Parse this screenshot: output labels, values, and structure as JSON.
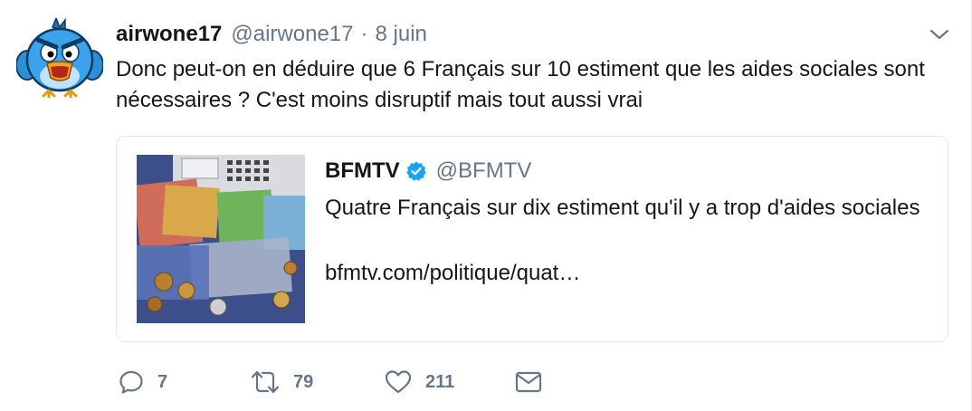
{
  "tweet": {
    "display_name": "airwone17",
    "handle": "@airwone17",
    "separator": "·",
    "date": "8 juin",
    "text": "Donc peut-on en déduire que 6 Français sur 10 estiment que les aides sociales sont nécessaires ? C'est moins disruptif mais tout aussi vrai"
  },
  "quote": {
    "display_name": "BFMTV",
    "handle": "@BFMTV",
    "text": "Quatre Français sur dix estiment qu'il y a trop d'aides sociales",
    "link": "bfmtv.com/politique/quat…"
  },
  "actions": {
    "replies": "7",
    "retweets": "79",
    "likes": "211"
  },
  "icons": {
    "reply": "reply-icon",
    "retweet": "retweet-icon",
    "like": "heart-icon",
    "dm": "envelope-icon",
    "more": "chevron-down-icon",
    "verified": "verified-badge-icon"
  },
  "colors": {
    "text": "#14171a",
    "secondary": "#657786",
    "verified": "#1da1f2",
    "border": "#e1e8ed"
  }
}
